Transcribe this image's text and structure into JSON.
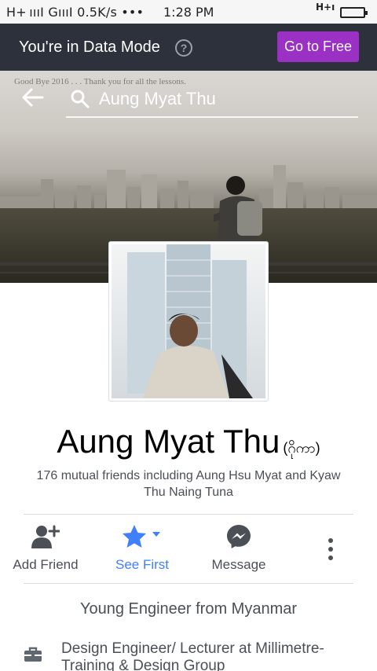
{
  "status_bar": {
    "left": "H+ ıııI GıııI 0.5K/s •••",
    "time": "1:28 PM",
    "network": "H+ı"
  },
  "banner": {
    "text": "You're in Data Mode",
    "help_icon": "question-circle-icon",
    "button": "Go to Free",
    "button_color": "#9b30c4"
  },
  "cover": {
    "overlay_text": "Good Bye 2016 . . . Thank you for all the lessons.",
    "search_text": "Aung Myat Thu",
    "icons": [
      "back-arrow-icon",
      "search-icon"
    ]
  },
  "profile": {
    "name": "Aung Myat Thu",
    "alternate_name": "(ဂိုကာ)",
    "mutual": "176 mutual friends including Aung Hsu Myat and Kyaw Thu Naing Tuna"
  },
  "actions": [
    {
      "label": "Add Friend",
      "icon": "add-friend-icon"
    },
    {
      "label": "See First",
      "icon": "star-icon",
      "active_color": "#4080ff"
    },
    {
      "label": "Message",
      "icon": "messenger-icon"
    }
  ],
  "more_icon": "more-vertical-icon",
  "intro": {
    "bio": "Young Engineer from Myanmar",
    "work": "Design Engineer/ Lecturer at Millimetre-Training & Design Group",
    "work_icon": "briefcase-icon"
  }
}
